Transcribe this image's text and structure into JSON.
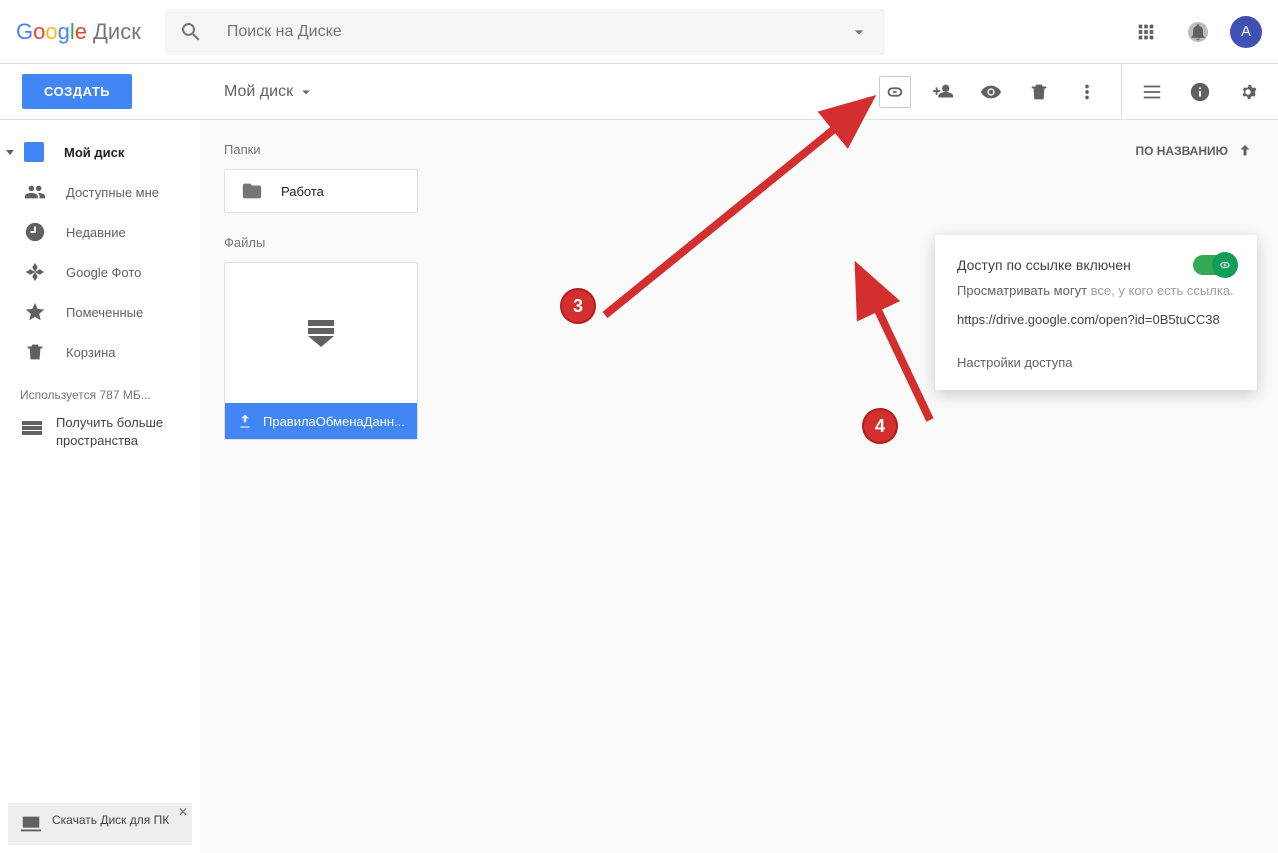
{
  "header": {
    "logo_suffix": "Диск",
    "search_placeholder": "Поиск на Диске",
    "avatar_letter": "A"
  },
  "toolbar": {
    "create_label": "СОЗДАТЬ",
    "breadcrumb": "Мой диск"
  },
  "sort": {
    "label": "ПО НАЗВАНИЮ"
  },
  "sidebar": {
    "items": [
      "Мой диск",
      "Доступные мне",
      "Недавние",
      "Google Фото",
      "Помеченные",
      "Корзина"
    ],
    "storage_text": "Используется 787 МБ...",
    "upsell_text": "Получить больше пространства",
    "download_text": "Скачать Диск для ПК"
  },
  "content": {
    "folders_label": "Папки",
    "files_label": "Файлы",
    "folder_name": "Работа",
    "file_name": "ПравилаОбменаДанн..."
  },
  "popover": {
    "title": "Доступ по ссылке включен",
    "sub_prefix": "Просматривать могут ",
    "sub_who": "все, у кого есть ссылка.",
    "url": "https://drive.google.com/open?id=0B5tuCC38",
    "settings": "Настройки доступа"
  },
  "annotations": {
    "badge3": "3",
    "badge4": "4"
  }
}
